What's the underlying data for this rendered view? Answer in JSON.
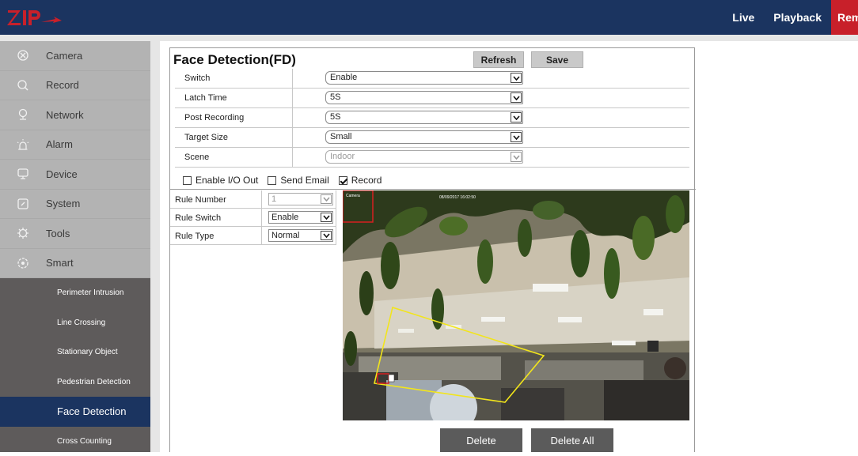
{
  "header": {
    "logo_text": "ZIP",
    "nav": [
      "Live",
      "Playback",
      "Rem"
    ]
  },
  "sidebar": {
    "items": [
      {
        "label": "Camera",
        "icon": "camera-icon"
      },
      {
        "label": "Record",
        "icon": "search-icon"
      },
      {
        "label": "Network",
        "icon": "network-icon"
      },
      {
        "label": "Alarm",
        "icon": "alarm-icon"
      },
      {
        "label": "Device",
        "icon": "device-icon"
      },
      {
        "label": "System",
        "icon": "system-icon"
      },
      {
        "label": "Tools",
        "icon": "gear-icon"
      },
      {
        "label": "Smart",
        "icon": "smart-icon"
      }
    ],
    "subitems": [
      "Perimeter Intrusion",
      "Line Crossing",
      "Stationary Object",
      "Pedestrian Detection",
      "Face Detection",
      "Cross Counting"
    ],
    "active_subitem": "Face Detection"
  },
  "panel": {
    "title": "Face Detection(FD)",
    "refresh_label": "Refresh",
    "save_label": "Save",
    "fields": [
      {
        "label": "Switch",
        "value": "Enable"
      },
      {
        "label": "Latch Time",
        "value": "5S"
      },
      {
        "label": "Post Recording",
        "value": "5S"
      },
      {
        "label": "Target Size",
        "value": "Small"
      },
      {
        "label": "Scene",
        "value": "Indoor",
        "disabled": true
      }
    ],
    "checkboxes": [
      {
        "label": "Enable I/O Out",
        "checked": false
      },
      {
        "label": "Send Email",
        "checked": false
      },
      {
        "label": "Record",
        "checked": true
      }
    ],
    "rules": [
      {
        "label": "Rule Number",
        "value": "1",
        "disabled": true
      },
      {
        "label": "Rule Switch",
        "value": "Enable"
      },
      {
        "label": "Rule Type",
        "value": "Normal"
      }
    ],
    "video": {
      "osd_camera": "Camera",
      "osd_time": "08/09/2017 16:02:50"
    },
    "delete_label": "Delete",
    "delete_all_label": "Delete All"
  },
  "colors": {
    "header_bg": "#1b3460",
    "remote_tab": "#c8202a",
    "sidebar_item": "#b3b3b3",
    "submenu_bg": "#5e5b5b",
    "active_submenu": "#1b3460",
    "region_outline": "#f2e51b"
  }
}
